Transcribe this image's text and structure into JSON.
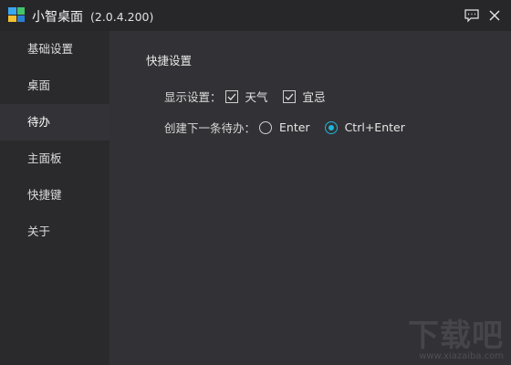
{
  "window": {
    "title": "小智桌面",
    "version": "(2.0.4.200)"
  },
  "sidebar": {
    "items": [
      {
        "label": "基础设置",
        "active": false
      },
      {
        "label": "桌面",
        "active": false
      },
      {
        "label": "待办",
        "active": true
      },
      {
        "label": "主面板",
        "active": false
      },
      {
        "label": "快捷键",
        "active": false
      },
      {
        "label": "关于",
        "active": false
      }
    ]
  },
  "main": {
    "section_title": "快捷设置",
    "display_settings": {
      "label": "显示设置：",
      "options": [
        {
          "label": "天气",
          "checked": true
        },
        {
          "label": "宜忌",
          "checked": true
        }
      ]
    },
    "create_todo": {
      "label": "创建下一条待办：",
      "options": [
        {
          "label": "Enter",
          "selected": false
        },
        {
          "label": "Ctrl+Enter",
          "selected": true
        }
      ]
    }
  },
  "watermark": {
    "main": "下载吧",
    "sub": "www.xiazaiba.com"
  },
  "colors": {
    "accent": "#1fb6d9",
    "sidebar_bg": "#2a2a2d",
    "content_bg": "#323236",
    "titlebar_bg": "#27272a"
  }
}
